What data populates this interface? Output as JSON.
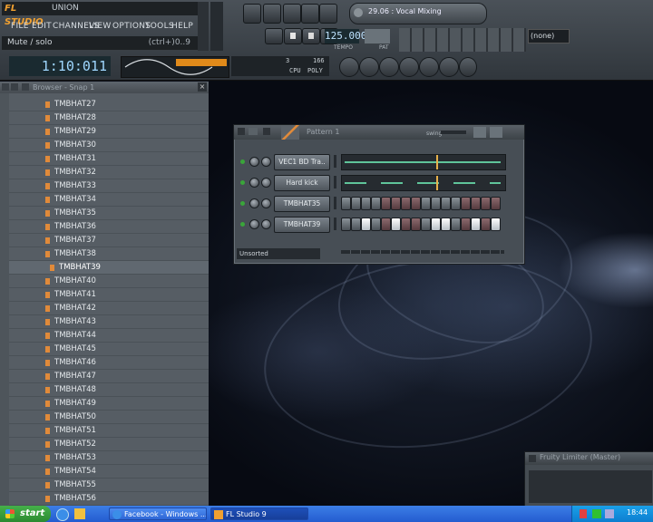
{
  "app": {
    "logo": "FL STUDIO",
    "project_name": "UNION",
    "hint_text": "Mute / solo",
    "hint_shortcut": "(ctrl+)0..9"
  },
  "menu": [
    "FILE",
    "EDIT",
    "CHANNELS",
    "VIEW",
    "OPTIONS",
    "TOOLS",
    "HELP"
  ],
  "transport": {
    "song_time": "1:10:011",
    "tempo": "125.000",
    "tempo_label": "TEMPO",
    "pat_label": "PAT",
    "preset": "29.06 : Vocal Mixing",
    "snap": "(none)",
    "cpu": "3",
    "poly": "166",
    "poly_label": "POLY",
    "cpu_label": "CPU"
  },
  "browser": {
    "title": "Browser - Snap 1",
    "items": [
      "TMBHAT27",
      "TMBHAT28",
      "TMBHAT29",
      "TMBHAT30",
      "TMBHAT31",
      "TMBHAT32",
      "TMBHAT33",
      "TMBHAT34",
      "TMBHAT35",
      "TMBHAT36",
      "TMBHAT37",
      "TMBHAT38",
      "TMBHAT39",
      "TMBHAT40",
      "TMBHAT41",
      "TMBHAT42",
      "TMBHAT43",
      "TMBHAT44",
      "TMBHAT45",
      "TMBHAT46",
      "TMBHAT47",
      "TMBHAT48",
      "TMBHAT49",
      "TMBHAT50",
      "TMBHAT51",
      "TMBHAT52",
      "TMBHAT53",
      "TMBHAT54",
      "TMBHAT55",
      "TMBHAT56"
    ],
    "selected": "TMBHAT39"
  },
  "channel_rack": {
    "title": "Pattern 1",
    "swing_label": "swing",
    "filter": "Unsorted",
    "channels": [
      {
        "name": "VEC1 BD Tra..",
        "type": "pianoroll"
      },
      {
        "name": "Hard kick",
        "type": "pianoroll"
      },
      {
        "name": "TMBHAT35",
        "type": "steps",
        "steps": [
          0,
          0,
          0,
          0,
          0,
          0,
          0,
          0,
          0,
          0,
          0,
          0,
          0,
          0,
          0,
          0
        ]
      },
      {
        "name": "TMBHAT39",
        "type": "steps",
        "steps": [
          0,
          0,
          1,
          0,
          0,
          1,
          0,
          0,
          0,
          1,
          1,
          0,
          0,
          1,
          0,
          1
        ]
      }
    ]
  },
  "limiter": {
    "title": "Fruity Limiter (Master)"
  },
  "taskbar": {
    "start": "start",
    "tasks": [
      "Facebook - Windows ...",
      "FL Studio 9"
    ],
    "clock": "18:44"
  }
}
